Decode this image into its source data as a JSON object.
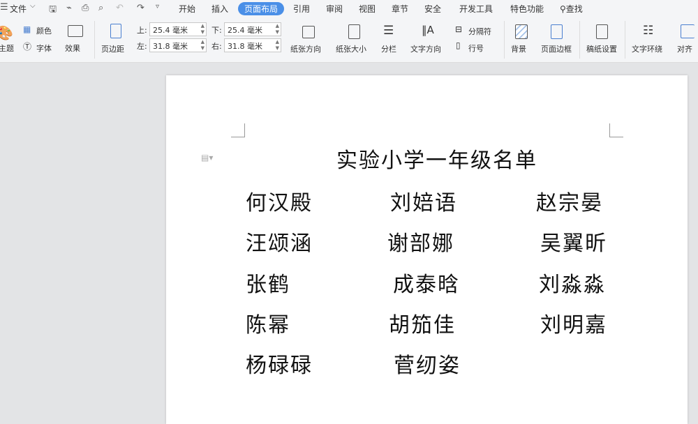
{
  "menu": {
    "file": "文件",
    "tabs": [
      "开始",
      "插入",
      "页面布局",
      "引用",
      "审阅",
      "视图",
      "章节",
      "安全",
      "开发工具",
      "特色功能"
    ],
    "active_tab": "页面布局",
    "search": "查找"
  },
  "ribbon": {
    "theme": "主题",
    "color": "颜色",
    "font": "字体",
    "effect": "效果",
    "margins": "页边距",
    "top_label": "上:",
    "top_value": "25.4 毫米",
    "bottom_label": "下:",
    "bottom_value": "25.4 毫米",
    "left_label": "左:",
    "left_value": "31.8 毫米",
    "right_label": "右:",
    "right_value": "31.8 毫米",
    "orientation": "纸张方向",
    "size": "纸张大小",
    "columns": "分栏",
    "text_direction": "文字方向",
    "breaks": "分隔符",
    "line_numbers": "行号",
    "background": "背景",
    "page_border": "页面边框",
    "manuscript": "稿纸设置",
    "text_wrap": "文字环绕",
    "align": "对齐"
  },
  "document": {
    "title": "实验小学一年级名单",
    "names": [
      [
        "何汉殿",
        "刘婄语",
        "赵宗晏"
      ],
      [
        "汪颂涵",
        "谢部娜",
        "吴翼昕"
      ],
      [
        "张鹤",
        "成泰晗",
        "刘淼淼"
      ],
      [
        "陈幂",
        "胡笳佳",
        "刘明嘉"
      ],
      [
        "杨碌碌",
        "菅纫姿",
        ""
      ]
    ]
  }
}
